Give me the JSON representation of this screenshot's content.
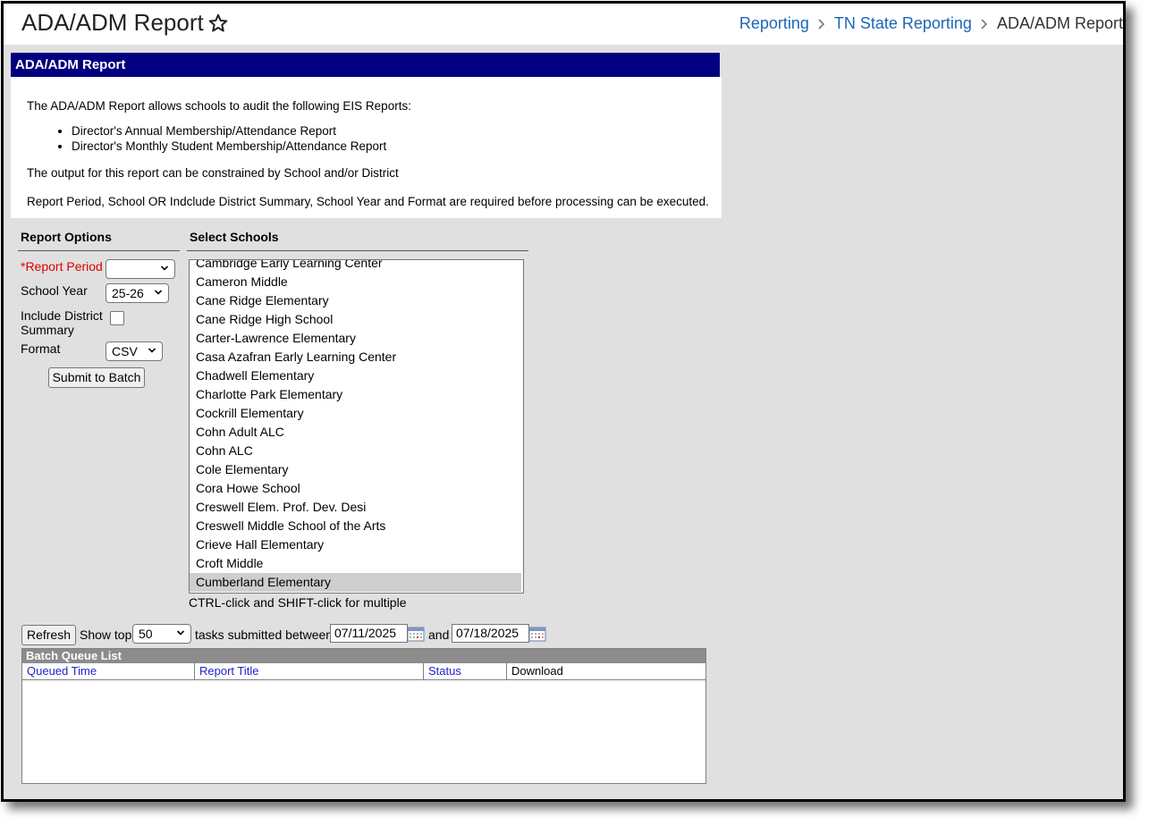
{
  "header": {
    "title": "ADA/ADM Report",
    "breadcrumbs": [
      "Reporting",
      "TN State Reporting",
      "ADA/ADM Report"
    ]
  },
  "panel": {
    "header": "ADA/ADM Report",
    "intro": "The ADA/ADM Report allows schools to audit the following EIS Reports:",
    "bullets": [
      "Director's Annual Membership/Attendance Report",
      "Director's Monthly Student Membership/Attendance Report"
    ],
    "constraint": "The output for this report can be constrained by School and/or District",
    "requirements": "Report Period, School OR Indclude District Summary, School Year and Format are required before processing can be executed."
  },
  "options": {
    "heading": "Report Options",
    "report_period_label": "*Report Period",
    "report_period_value": "",
    "school_year_label": "School Year",
    "school_year_value": "25-26",
    "district_summary_label_1": "Include District",
    "district_summary_label_2": "Summary",
    "format_label": "Format",
    "format_value": "CSV",
    "submit_label": "Submit to Batch"
  },
  "schools": {
    "heading": "Select Schools",
    "items": [
      "Cambridge Early Learning Center",
      "Cameron Middle",
      "Cane Ridge Elementary",
      "Cane Ridge High School",
      "Carter-Lawrence Elementary",
      "Casa Azafran Early Learning Center",
      "Chadwell Elementary",
      "Charlotte Park Elementary",
      "Cockrill Elementary",
      "Cohn Adult ALC",
      "Cohn ALC",
      "Cole Elementary",
      "Cora Howe School",
      "Creswell Elem. Prof. Dev. Desi",
      "Creswell Middle School of the Arts",
      "Crieve Hall Elementary",
      "Croft Middle",
      "Cumberland Elementary"
    ],
    "selected_index": 17,
    "hint": "CTRL-click and SHIFT-click for multiple"
  },
  "batch": {
    "refresh_label": "Refresh",
    "show_top_label": "Show top",
    "show_top_value": "50",
    "between_label": "tasks submitted between",
    "start_date": "07/11/2025",
    "and_label": "and",
    "end_date": "07/18/2025",
    "queue_title": "Batch Queue List",
    "columns": [
      "Queued Time",
      "Report Title",
      "Status",
      "Download"
    ]
  },
  "colors": {
    "panel_header_bg": "#000080",
    "link": "#1a66b8",
    "required": "#e00000"
  }
}
